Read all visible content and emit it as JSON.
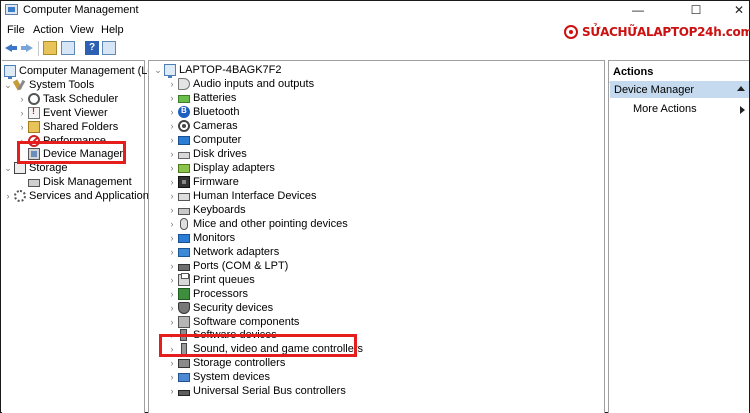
{
  "window": {
    "title": "Computer Management",
    "controls": {
      "minimize": "—",
      "maximize": "☐",
      "close": "✕"
    }
  },
  "menu": [
    "File",
    "Action",
    "View",
    "Help"
  ],
  "watermark": "SỬACHỮALAPTOP24h.com",
  "toolbar": {
    "icons": [
      "back-icon",
      "forward-icon",
      "up-level-icon",
      "show-hide-tree-icon",
      "help-icon",
      "properties-icon"
    ]
  },
  "tree": {
    "root": "Computer Management (Local)",
    "system_tools": "System Tools",
    "task_scheduler": "Task Scheduler",
    "event_viewer": "Event Viewer",
    "shared_folders": "Shared Folders",
    "performance": "Performance",
    "device_manager": "Device Manager",
    "storage": "Storage",
    "disk_management": "Disk Management",
    "services": "Services and Applications"
  },
  "devices": {
    "computer_name": "LAPTOP-4BAGK7F2",
    "categories": [
      "Audio inputs and outputs",
      "Batteries",
      "Bluetooth",
      "Cameras",
      "Computer",
      "Disk drives",
      "Display adapters",
      "Firmware",
      "Human Interface Devices",
      "Keyboards",
      "Mice and other pointing devices",
      "Monitors",
      "Network adapters",
      "Ports (COM & LPT)",
      "Print queues",
      "Processors",
      "Security devices",
      "Software components",
      "Software devices",
      "Sound, video and game controllers",
      "Storage controllers",
      "System devices",
      "Universal Serial Bus controllers"
    ]
  },
  "actions": {
    "title": "Actions",
    "section": "Device Manager",
    "more": "More Actions"
  },
  "colors": {
    "highlight": "#e51d1d",
    "section_bg": "#c5daee",
    "watermark": "#cc1111"
  }
}
